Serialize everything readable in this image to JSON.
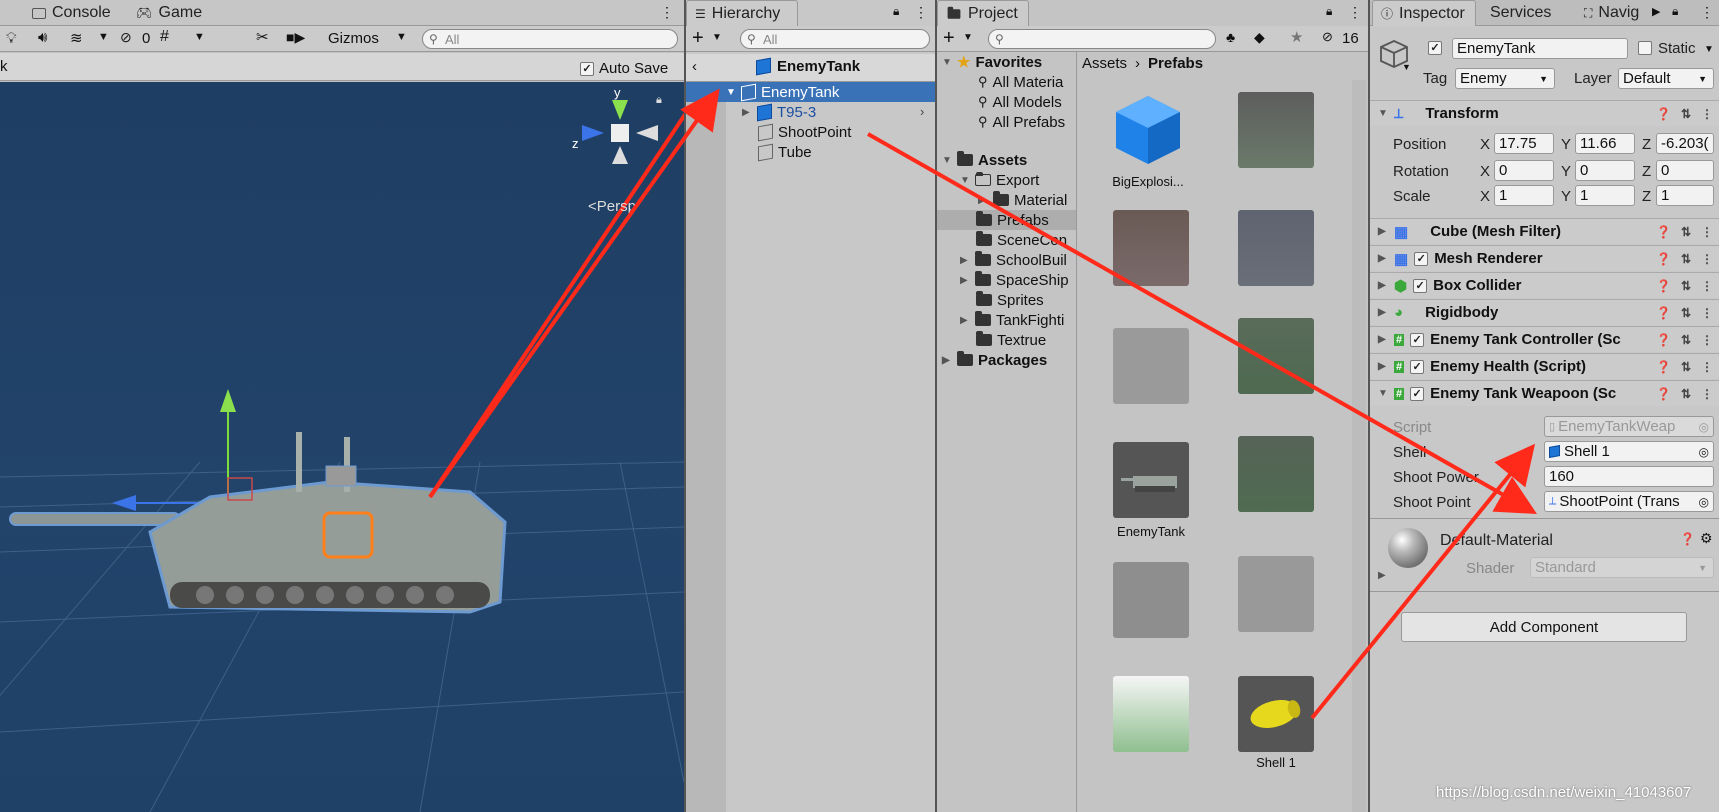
{
  "scene": {
    "tabs": [
      "Console",
      "Game"
    ],
    "toolbar": {
      "hidden_count": "0",
      "gizmos_label": "Gizmos",
      "search_placeholder": "All"
    },
    "breadcrumb_fragment": "k",
    "auto_save_label": "Auto Save",
    "gizmo_axes": {
      "y": "y",
      "z": "z"
    },
    "persp_label": "Persp"
  },
  "hierarchy": {
    "tab_label": "Hierarchy",
    "search_placeholder": "All",
    "header_title": "EnemyTank",
    "items": [
      {
        "label": "EnemyTank"
      },
      {
        "label": "T95-3"
      },
      {
        "label": "ShootPoint"
      },
      {
        "label": "Tube"
      }
    ]
  },
  "project": {
    "tab_label": "Project",
    "hidden_count": "16",
    "favorites": {
      "label": "Favorites",
      "items": [
        "All Materia",
        "All Models",
        "All Prefabs"
      ]
    },
    "assets": {
      "label": "Assets",
      "folders": [
        "Export",
        "Material",
        "Prefabs",
        "SceneCon",
        "SchoolBuil",
        "SpaceShip",
        "Sprites",
        "TankFighti",
        "Textrue"
      ]
    },
    "packages_label": "Packages",
    "breadcrumb": [
      "Assets",
      "Prefabs"
    ],
    "grid_captions": [
      "BigExplosi...",
      "EnemyTank",
      "Shell 1"
    ]
  },
  "inspector": {
    "tabs": [
      "Inspector",
      "Services",
      "Navig"
    ],
    "object_name": "EnemyTank",
    "static_label": "Static",
    "tag_label": "Tag",
    "tag_value": "Enemy",
    "layer_label": "Layer",
    "layer_value": "Default",
    "transform": {
      "title": "Transform",
      "position": {
        "label": "Position",
        "x": "17.75",
        "y": "11.66",
        "z": "-6.203("
      },
      "rotation": {
        "label": "Rotation",
        "x": "0",
        "y": "0",
        "z": "0"
      },
      "scale": {
        "label": "Scale",
        "x": "1",
        "y": "1",
        "z": "1"
      },
      "axis_x": "X",
      "axis_y": "Y",
      "axis_z": "Z"
    },
    "components": [
      "Cube (Mesh Filter)",
      "Mesh Renderer",
      "Box Collider",
      "Rigidbody",
      "Enemy Tank Controller (Sc",
      "Enemy Health (Script)",
      "Enemy Tank Weapoon (Sc"
    ],
    "weapon": {
      "script_label": "Script",
      "script_value": "EnemyTankWeap",
      "shell_label": "Shell",
      "shell_value": "Shell 1",
      "power_label": "Shoot Power",
      "power_value": "160",
      "point_label": "Shoot Point",
      "point_value": "ShootPoint (Trans"
    },
    "material": {
      "name": "Default-Material",
      "shader_label": "Shader",
      "shader_value": "Standard"
    },
    "add_component_label": "Add Component"
  },
  "watermark": "https://blog.csdn.net/weixin_41043607"
}
